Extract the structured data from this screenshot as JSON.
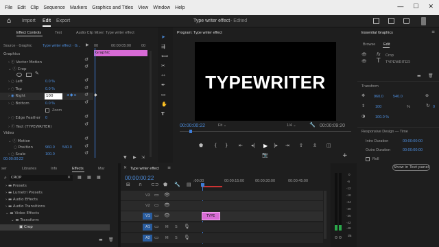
{
  "menu": {
    "items": [
      "File",
      "Edit",
      "Clip",
      "Sequence",
      "Markers",
      "Graphics and Titles",
      "View",
      "Window",
      "Help"
    ],
    "minimize": "—",
    "maximize": "☐",
    "close": "✕"
  },
  "header": {
    "tabs": [
      "Import",
      "Edit",
      "Export"
    ],
    "active_tab": "Edit",
    "project_title": "Type writer effect",
    "edited_status": "- Edited"
  },
  "effect_controls": {
    "tabs": [
      "Effect Controls",
      "Text",
      "Audio Clip Mixer: Type writer effect"
    ],
    "source_label": "Source · Graphic",
    "sequence_label": "Type writer effect · G...",
    "ruler_start": "00",
    "ruler_mid": "00:00:05:00",
    "ruler_end": "00",
    "clip_label": "Graphic",
    "graphics_header": "Graphics",
    "vector_motion": "Vector Motion",
    "crop": "Crop",
    "left_label": "Left",
    "left_value": "0.0 %",
    "top_label": "Top",
    "top_value": "0.0 %",
    "right_label": "Right",
    "right_value": "100",
    "bottom_label": "Bottom",
    "bottom_value": "0.0 %",
    "zoom_label": "Zoom",
    "edge_feather_label": "Edge Feather",
    "edge_feather_value": "0",
    "text_layer": "Text (TYPEWRITER)",
    "video_header": "Video",
    "motion": "Motion",
    "position_label": "Position",
    "position_x": "960.0",
    "position_y": "540.0",
    "scale_label": "Scale",
    "scale_value": "100.0",
    "timecode": "00:00:00:22"
  },
  "program": {
    "title": "Program: Type writer effect",
    "video_text": "TYPEWRITER",
    "timecode": "00:00:00:22",
    "fit": "Fit",
    "resolution": "1/4",
    "duration": "00:00:09:20"
  },
  "essential_graphics": {
    "title": "Essential Graphics",
    "tabs": [
      "Browse",
      "Edit"
    ],
    "active_tab": "Edit",
    "layer_crop": "Crop",
    "layer_text": "TYPEWRITER",
    "transform_header": "Transform",
    "pos_x": "960.0",
    "pos_y": "540.0",
    "scale": "100",
    "scale_unit": "%",
    "rotation": "0",
    "opacity": "100.0 %",
    "responsive_header": "Responsive Design — Time",
    "intro_label": "Intro Duration",
    "intro_value": "00:00:00:00",
    "outro_label": "Outro Duration",
    "outro_value": "00:00:00:00",
    "roll_label": "Roll",
    "show_button": "Show in Text panel"
  },
  "effects_panel": {
    "tabs": [
      "ser",
      "Libraries",
      "Info",
      "Effects",
      "Mar"
    ],
    "active_tab": "Effects",
    "search_value": "CROP",
    "tree": [
      "Presets",
      "Lumetri Presets",
      "Audio Effects",
      "Audio Transitions",
      "Video Effects",
      "Transform",
      "Crop"
    ]
  },
  "timeline": {
    "title": "Type writer effect",
    "timecode": "00:00:00:22",
    "ruler": [
      ":00:00",
      "00:00:15:00",
      "00:00:30:00",
      "00:00:45:00"
    ],
    "tracks": [
      "V3",
      "V2",
      "V1",
      "A1",
      "A2"
    ],
    "clip_label": "TYPE",
    "mute": "M",
    "solo": "S"
  },
  "meter": {
    "labels": [
      "0",
      "-6",
      "-12",
      "-18",
      "-24",
      "-30",
      "-36",
      "-42",
      "-48",
      "dB"
    ]
  },
  "colors": {
    "accent_blue": "#4d8fe0",
    "clip_pink": "#d86bd6",
    "playhead_blue": "#3d7dd8"
  }
}
